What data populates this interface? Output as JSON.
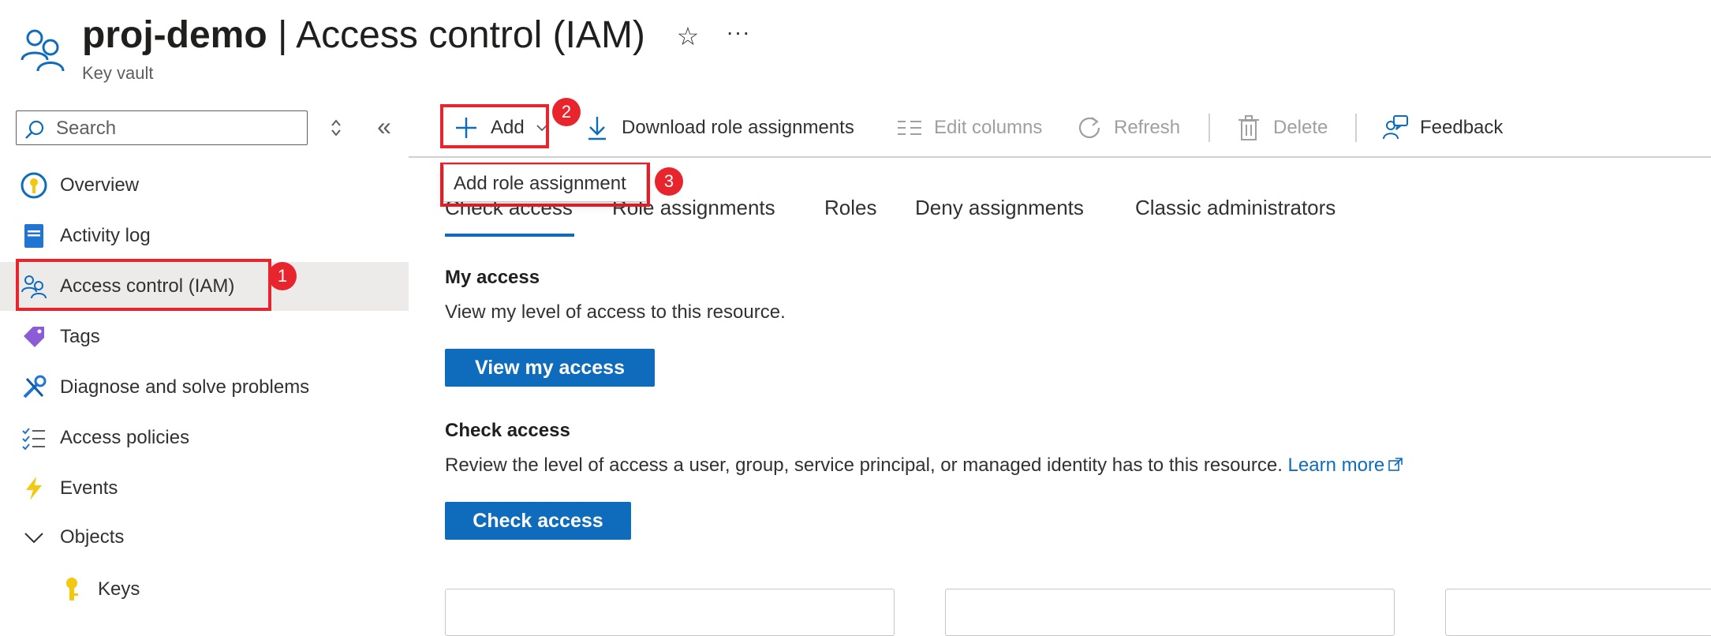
{
  "header": {
    "resource_name": "proj-demo",
    "separator": " | ",
    "page_title": "Access control (IAM)",
    "resource_type": "Key vault",
    "favorite_icon": "star-icon",
    "more_icon": "ellipsis-icon",
    "more_text": "···"
  },
  "sidebar": {
    "search": {
      "placeholder": "Search",
      "value": ""
    },
    "collapse_glyph": "«",
    "items": [
      {
        "label": "Overview",
        "icon": "key-vault-overview-icon"
      },
      {
        "label": "Activity log",
        "icon": "activity-log-icon"
      },
      {
        "label": "Access control (IAM)",
        "icon": "people-icon",
        "active": true
      },
      {
        "label": "Tags",
        "icon": "tag-icon"
      },
      {
        "label": "Diagnose and solve problems",
        "icon": "wrench-icon"
      },
      {
        "label": "Access policies",
        "icon": "checklist-icon"
      },
      {
        "label": "Events",
        "icon": "lightning-icon"
      },
      {
        "label": "Objects",
        "icon": "chevron-down-icon"
      },
      {
        "label": "Keys",
        "icon": "key-icon",
        "child": true
      }
    ]
  },
  "command_bar": {
    "add": "Add",
    "download": "Download role assignments",
    "edit_columns": "Edit columns",
    "refresh": "Refresh",
    "delete": "Delete",
    "feedback": "Feedback"
  },
  "dropdown": {
    "items": [
      "Add role assignment"
    ]
  },
  "annotations": {
    "badges": [
      "1",
      "2",
      "3"
    ],
    "color": "#e8242d"
  },
  "tabs": [
    "Check access",
    "Role assignments",
    "Roles",
    "Deny assignments",
    "Classic administrators"
  ],
  "active_tab": "Check access",
  "my_access": {
    "heading": "My access",
    "description": "View my level of access to this resource.",
    "button": "View my access"
  },
  "check_access": {
    "heading": "Check access",
    "description": "Review the level of access a user, group, service principal, or managed identity has to this resource.",
    "learn_more": "Learn more",
    "button": "Check access"
  },
  "colors": {
    "accent": "#0f6cbd",
    "active_nav_bg": "#edebe9",
    "annotation": "#e8242d"
  }
}
